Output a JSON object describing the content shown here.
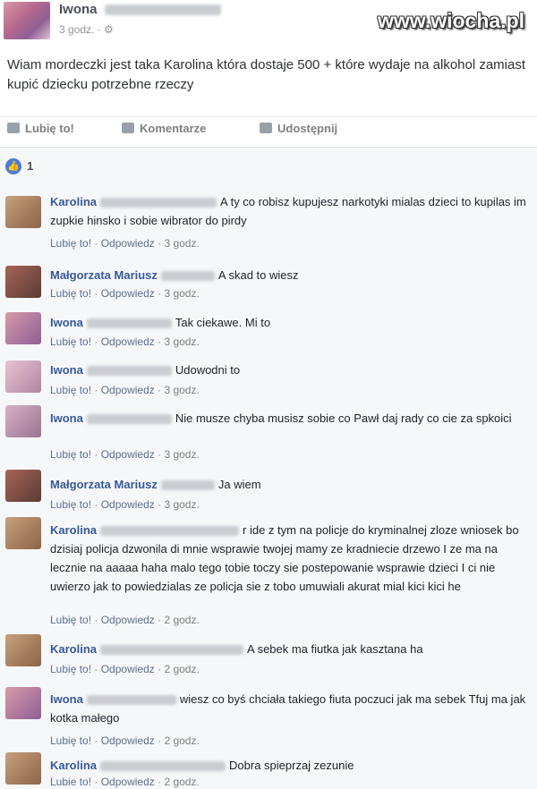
{
  "post": {
    "author": "Iwona",
    "time": "3 godz. · ⚙",
    "text": "Wiam mordeczki jest taka Karolina                              która dostaje 500 + które wydaje na alkohol zamiast kupić dziecku potrzebne rzeczy",
    "watermark": "www.wiocha.pl"
  },
  "actions": {
    "like": "Lubię to!",
    "comment": "Komentarze",
    "share": "Udostępnij"
  },
  "likes": {
    "count": "1",
    "icon": "thumbs-up-icon"
  },
  "comments": [
    {
      "name": "Karolina",
      "text": "A ty co robisz kupujesz narkotyki mialas dzieci to kupilas im zupkie hinsko i sobie wibrator do pirdy",
      "like": "Lubię to!",
      "reply": "Odpowiedz",
      "time": "3 godz."
    },
    {
      "name": "Małgorzata Mariusz",
      "text": "A skad to wiesz",
      "like": "Lubię to!",
      "reply": "Odpowiedz",
      "time": "3 godz."
    },
    {
      "name": "Iwona",
      "text": "Tak ciekawe. Mi to",
      "like": "Lubię to!",
      "reply": "Odpowiedz",
      "time": "3 godz."
    },
    {
      "name": "Iwona",
      "text": "Udowodni to",
      "like": "Lubię to!",
      "reply": "Odpowiedz",
      "time": "3 godz."
    },
    {
      "name": "Iwona",
      "text": "Nie musze chyba musisz sobie co Pawł daj rady co cie za spkoici",
      "like": "Lubię to!",
      "reply": "Odpowiedz",
      "time": "3 godz."
    },
    {
      "name": "Małgorzata Mariusz",
      "text": "Ja wiem",
      "like": "Lubię to!",
      "reply": "Odpowiedz",
      "time": "3 godz."
    },
    {
      "name": "Karolina",
      "text": "r ide z tym na policje do kryminalnej zloze wniosek bo dzisiaj policja dzwonila di mnie wsprawie twojej mamy ze kradniecie drzewo I ze ma na lecznie na aaaaa haha malo tego tobie toczy sie postepowanie wsprawie dzieci I ci nie uwierzo jak to powiedzialas ze policja sie z tobo umuwiali akurat mial kici kici he",
      "like": "Lubię to!",
      "reply": "Odpowiedz",
      "time": "2 godz."
    },
    {
      "name": "Karolina",
      "text": "A sebek ma fiutka jak kasztana ha",
      "like": "Lubię to!",
      "reply": "Odpowiedz",
      "time": "2 godz."
    },
    {
      "name": "Iwona",
      "text": "wiesz co byś chciała takiego fiuta poczuci jak ma sebek Tfuj ma jak kotka małego",
      "like": "Lubię to!",
      "reply": "Odpowiedz",
      "time": "2 godz."
    },
    {
      "name": "Karolina",
      "text": "Dobra spieprzaj zezunie",
      "like": "Lubie to!",
      "reply": "Odpowiedz",
      "time": "2 godz."
    }
  ]
}
